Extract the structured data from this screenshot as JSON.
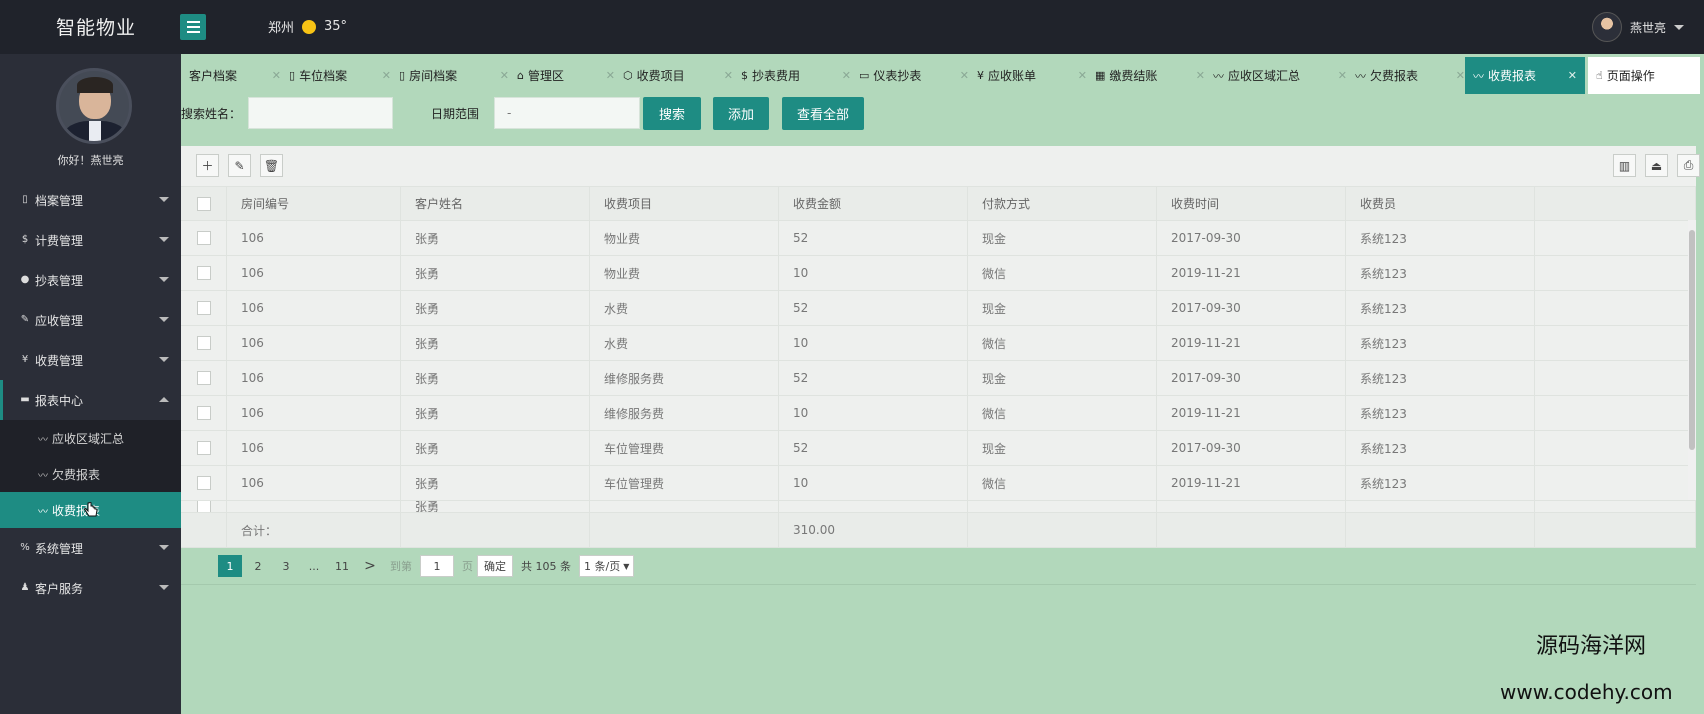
{
  "app": {
    "title": "智能物业",
    "city": "郑州",
    "temperature": "35°",
    "user_name": "燕世亮"
  },
  "sidebar": {
    "greeting": "你好！燕世亮",
    "items": [
      {
        "label": "档案管理",
        "icon": "file-icon"
      },
      {
        "label": "计费管理",
        "icon": "dollar-icon"
      },
      {
        "label": "抄表管理",
        "icon": "meter-icon"
      },
      {
        "label": "应收管理",
        "icon": "edit-icon"
      },
      {
        "label": "收费管理",
        "icon": "yen-icon"
      },
      {
        "label": "报表中心",
        "icon": "report-icon"
      }
    ],
    "sub_items": [
      {
        "label": "应收区域汇总"
      },
      {
        "label": "欠费报表"
      },
      {
        "label": "收费报表"
      }
    ],
    "items_after": [
      {
        "label": "系统管理",
        "icon": "percent-icon"
      },
      {
        "label": "客户服务",
        "icon": "user-icon"
      }
    ]
  },
  "tabs": [
    {
      "label": "客户档案",
      "icon": ""
    },
    {
      "label": "车位档案",
      "icon": "file-icon"
    },
    {
      "label": "房间档案",
      "icon": "file-icon"
    },
    {
      "label": "管理区",
      "icon": "home-icon"
    },
    {
      "label": "收费项目",
      "icon": "cube-icon"
    },
    {
      "label": "抄表费用",
      "icon": "dollar-icon"
    },
    {
      "label": "仪表抄表",
      "icon": "book-icon"
    },
    {
      "label": "应收账单",
      "icon": "yen-icon"
    },
    {
      "label": "缴费结账",
      "icon": "calendar-icon"
    },
    {
      "label": "应收区域汇总",
      "icon": "pulse-icon"
    },
    {
      "label": "欠费报表",
      "icon": "pulse-icon"
    },
    {
      "label": "收费报表",
      "icon": "pulse-icon"
    }
  ],
  "page_ops_tab": {
    "label": "页面操作"
  },
  "search": {
    "name_label": "搜索姓名：",
    "name_value": "",
    "date_label": "日期范围",
    "date_value": "-",
    "search_btn": "搜索",
    "add_btn": "添加",
    "view_all_btn": "查看全部"
  },
  "table": {
    "columns": [
      "房间编号",
      "客户姓名",
      "收费项目",
      "收费金额",
      "付款方式",
      "收费时间",
      "收费员"
    ],
    "rows": [
      [
        "106",
        "张勇",
        "物业费",
        "52",
        "现金",
        "2017-09-30",
        "系统123"
      ],
      [
        "106",
        "张勇",
        "物业费",
        "10",
        "微信",
        "2019-11-21",
        "系统123"
      ],
      [
        "106",
        "张勇",
        "水费",
        "52",
        "现金",
        "2017-09-30",
        "系统123"
      ],
      [
        "106",
        "张勇",
        "水费",
        "10",
        "微信",
        "2019-11-21",
        "系统123"
      ],
      [
        "106",
        "张勇",
        "维修服务费",
        "52",
        "现金",
        "2017-09-30",
        "系统123"
      ],
      [
        "106",
        "张勇",
        "维修服务费",
        "10",
        "微信",
        "2019-11-21",
        "系统123"
      ],
      [
        "106",
        "张勇",
        "车位管理费",
        "52",
        "现金",
        "2017-09-30",
        "系统123"
      ],
      [
        "106",
        "张勇",
        "车位管理费",
        "10",
        "微信",
        "2019-11-21",
        "系统123"
      ],
      [
        "",
        "张勇",
        "",
        "",
        "",
        "",
        ""
      ]
    ],
    "footer_label": "合计：",
    "footer_total": "310.00"
  },
  "pagination": {
    "pages": [
      "1",
      "2",
      "3",
      "...",
      "11"
    ],
    "next": ">",
    "goto_label": "到第",
    "goto_value": "1",
    "page_unit": "页",
    "ok": "确定",
    "total": "共 105 条",
    "page_size": "1 条/页"
  },
  "watermark": {
    "line1": "源码海洋网",
    "line2": "www.codehy.com"
  },
  "colors": {
    "accent": "#1e8c83",
    "sidebar": "#2b2e38",
    "topbar": "#20232b",
    "background": "#b2d8bb"
  }
}
